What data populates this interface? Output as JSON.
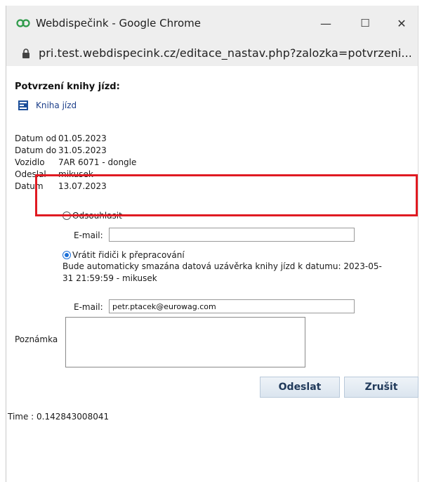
{
  "window": {
    "title": "Webdispečink - Google Chrome",
    "minimize": "—",
    "maximize": "☐",
    "close": "✕"
  },
  "address": {
    "url": "pri.test.webdispecink.cz/editace_nastav.php?zalozka=potvrzeni..."
  },
  "page": {
    "heading": "Potvrzení knihy jízd:",
    "book_link": "Kniha jízd",
    "info": [
      {
        "label": "Datum od",
        "value": "01.05.2023"
      },
      {
        "label": "Datum do",
        "value": "31.05.2023"
      },
      {
        "label": "Vozidlo",
        "value": "7AR 6071 - dongle"
      },
      {
        "label": "Odeslal",
        "value": "mikusek"
      },
      {
        "label": "Datum",
        "value": "13.07.2023"
      }
    ],
    "option_disapprove": "Odsouhlasit",
    "email_label": "E-mail:",
    "email_value_1": "",
    "option_return": "Vrátit řidiči k přepracování",
    "notice_line1": "Bude automaticky smazána datová uzávěrka knihy jízd k datumu: 2023-05-",
    "notice_line2": "31 21:59:59 - mikusek",
    "email_value_2": "petr.ptacek@eurowag.com",
    "note_label": "Poznámka",
    "note_value": "",
    "send_button": "Odeslat",
    "cancel_button": "Zrušit",
    "time": "Time : 0.142843008041"
  },
  "colors": {
    "highlight": "#e01a22",
    "link": "#1d3f8a",
    "radio_selected": "#1a6fd8"
  }
}
